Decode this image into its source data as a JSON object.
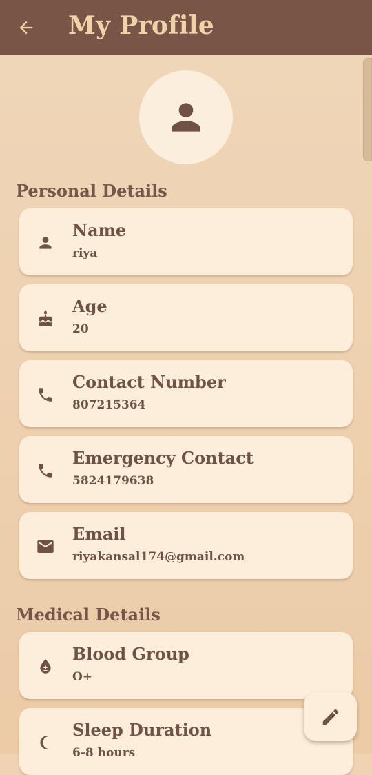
{
  "app_bar": {
    "title": "My Profile",
    "back_icon": "arrow-back-icon"
  },
  "avatar_icon": "person-icon",
  "sections": {
    "personal": {
      "title": "Personal Details",
      "items": [
        {
          "icon": "person-icon",
          "label": "Name",
          "value": "riya"
        },
        {
          "icon": "cake-icon",
          "label": "Age",
          "value": "20"
        },
        {
          "icon": "phone-icon",
          "label": "Contact Number",
          "value": "807215364"
        },
        {
          "icon": "phone-icon",
          "label": "Emergency Contact",
          "value": "5824179638"
        },
        {
          "icon": "email-icon",
          "label": "Email",
          "value": "riyakansal174@gmail.com"
        }
      ]
    },
    "medical": {
      "title": "Medical Details",
      "items": [
        {
          "icon": "blood-drop-icon",
          "label": "Blood Group",
          "value": "O+"
        },
        {
          "icon": "moon-icon",
          "label": "Sleep Duration",
          "value": "6-8 hours"
        }
      ]
    }
  },
  "fab": {
    "icon": "edit-pencil-icon"
  },
  "colors": {
    "app_bar": "#795548",
    "title_text": "#f0d2a8",
    "background": "#efd3b3",
    "card": "#fdeedc",
    "text": "#6f5245"
  }
}
